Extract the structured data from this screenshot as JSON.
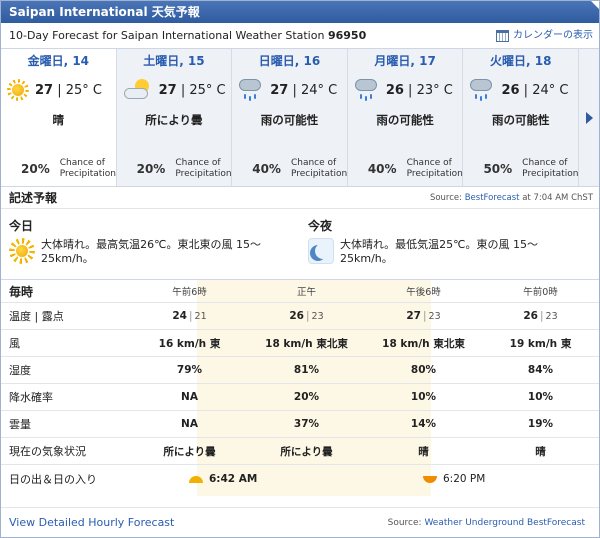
{
  "window": {
    "title": "Saipan International 天気予報"
  },
  "header": {
    "subtitle_prefix": "10-Day Forecast for Saipan International Weather Station",
    "station_id": "96950",
    "calendar_link": "カレンダーの表示",
    "calendar_icon": "calendar-icon"
  },
  "days": [
    {
      "name": "金曜日, 14",
      "icon": "sun-icon",
      "hi": "27",
      "lo": "25° C",
      "condition": "晴",
      "chance_pct": "20%",
      "chance_label_1": "Chance of",
      "chance_label_2": "Precipitation"
    },
    {
      "name": "土曜日, 15",
      "icon": "partly-cloudy-icon",
      "hi": "27",
      "lo": "25° C",
      "condition": "所により曇",
      "chance_pct": "20%",
      "chance_label_1": "Chance of",
      "chance_label_2": "Precipitation"
    },
    {
      "name": "日曜日, 16",
      "icon": "rain-cloud-icon",
      "hi": "27",
      "lo": "24° C",
      "condition": "雨の可能性",
      "chance_pct": "40%",
      "chance_label_1": "Chance of",
      "chance_label_2": "Precipitation"
    },
    {
      "name": "月曜日, 17",
      "icon": "rain-cloud-icon",
      "hi": "26",
      "lo": "23° C",
      "condition": "雨の可能性",
      "chance_pct": "40%",
      "chance_label_1": "Chance of",
      "chance_label_2": "Precipitation"
    },
    {
      "name": "火曜日, 18",
      "icon": "rain-cloud-icon",
      "hi": "26",
      "lo": "24° C",
      "condition": "雨の可能性",
      "chance_pct": "50%",
      "chance_label_1": "Chance of",
      "chance_label_2": "Precipitation"
    }
  ],
  "narrative": {
    "heading": "記述予報",
    "source_prefix": "Source:",
    "source_link": "BestForecast",
    "source_suffix": "at 7:04 AM ChST",
    "today": {
      "title": "今日",
      "text": "大体晴れ。最高気温26℃。東北東の風 15～25km/h。"
    },
    "tonight": {
      "title": "今夜",
      "text": "大体晴れ。最低気温25℃。東の風 15～25km/h。"
    }
  },
  "hourly": {
    "heading": "毎時",
    "times": [
      "午前6時",
      "正午",
      "午後6時",
      "午前0時"
    ],
    "rows": [
      {
        "label": "温度 | 露点",
        "cells": [
          [
            "24",
            "21"
          ],
          [
            "26",
            "23"
          ],
          [
            "27",
            "23"
          ],
          [
            "26",
            "23"
          ]
        ]
      },
      {
        "label": "風",
        "cells": [
          "16 km/h 東",
          "18 km/h 東北東",
          "18 km/h 東北東",
          "19 km/h 東"
        ]
      },
      {
        "label": "湿度",
        "cells": [
          "79%",
          "81%",
          "80%",
          "84%"
        ]
      },
      {
        "label": "降水確率",
        "cells": [
          "NA",
          "20%",
          "10%",
          "10%"
        ]
      },
      {
        "label": "雲量",
        "cells": [
          "NA",
          "37%",
          "14%",
          "19%"
        ]
      },
      {
        "label": "現在の気象状況",
        "cells": [
          "所により曇",
          "所により曇",
          "晴",
          "晴"
        ]
      }
    ],
    "sun_label": "日の出＆日の入り",
    "sunrise": "6:42 AM",
    "sunset": "6:20 PM"
  },
  "footer": {
    "hourly_link": "View Detailed Hourly Forecast",
    "source_prefix": "Source:",
    "source_link": "Weather Underground BestForecast"
  },
  "colors": {
    "accent": "#2f5b9f",
    "link": "#2a5db0",
    "highlight": "#fdf7e6",
    "sun": "#f2b100"
  }
}
